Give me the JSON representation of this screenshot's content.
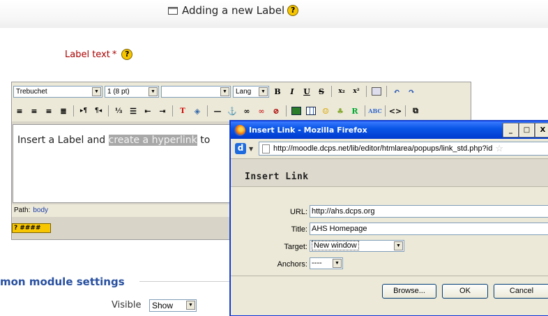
{
  "header": {
    "title": "Adding a new Label"
  },
  "form": {
    "label_text_label": "Label text",
    "required_mark": "*",
    "module_settings_heading": "mon module settings",
    "visible_label": "Visible",
    "visible_value": "Show"
  },
  "editor": {
    "font_family": "Trebuchet",
    "font_size": "1 (8 pt)",
    "heading_value": "",
    "lang_label": "Lang",
    "content_plain": "Insert a Label and ",
    "content_highlight": "create a hyperlink",
    "content_after": " to",
    "path_label": "Path:",
    "path_value": "body",
    "help_badge": "? ####"
  },
  "toolbar_icons": {
    "row1": [
      "bold-icon",
      "italic-icon",
      "underline-icon",
      "strikethrough-icon",
      "subscript-icon",
      "superscript-icon",
      "paste-word-icon",
      "undo-icon",
      "redo-icon"
    ],
    "row2": [
      "align-left-icon",
      "align-center-icon",
      "align-right-icon",
      "justify-icon",
      "ltr-icon",
      "rtl-icon",
      "ordered-list-icon",
      "unordered-list-icon",
      "outdent-icon",
      "indent-icon",
      "text-color-icon",
      "background-color-icon",
      "horizontal-rule-icon",
      "anchor-icon",
      "link-icon",
      "unlink-icon",
      "nolink-icon",
      "image-icon",
      "table-icon",
      "smiley-icon",
      "special-char-icon",
      "search-replace-icon",
      "spellcheck-icon",
      "html-source-icon",
      "fullscreen-icon"
    ]
  },
  "popup": {
    "window_title": "Insert Link - Mozilla Firefox",
    "url": "http://moodle.dcps.net/lib/editor/htmlarea/popups/link_std.php?id",
    "heading": "Insert Link",
    "fields": {
      "url_label": "URL:",
      "url_value": "http://ahs.dcps.org",
      "title_label": "Title:",
      "title_value": "AHS Homepage",
      "target_label": "Target:",
      "target_value": "New window",
      "anchors_label": "Anchors:",
      "anchors_value": "----"
    },
    "buttons": {
      "browse": "Browse...",
      "ok": "OK",
      "cancel": "Cancel"
    },
    "window_controls": {
      "minimize": "_",
      "maximize": "□",
      "close": "X"
    }
  }
}
